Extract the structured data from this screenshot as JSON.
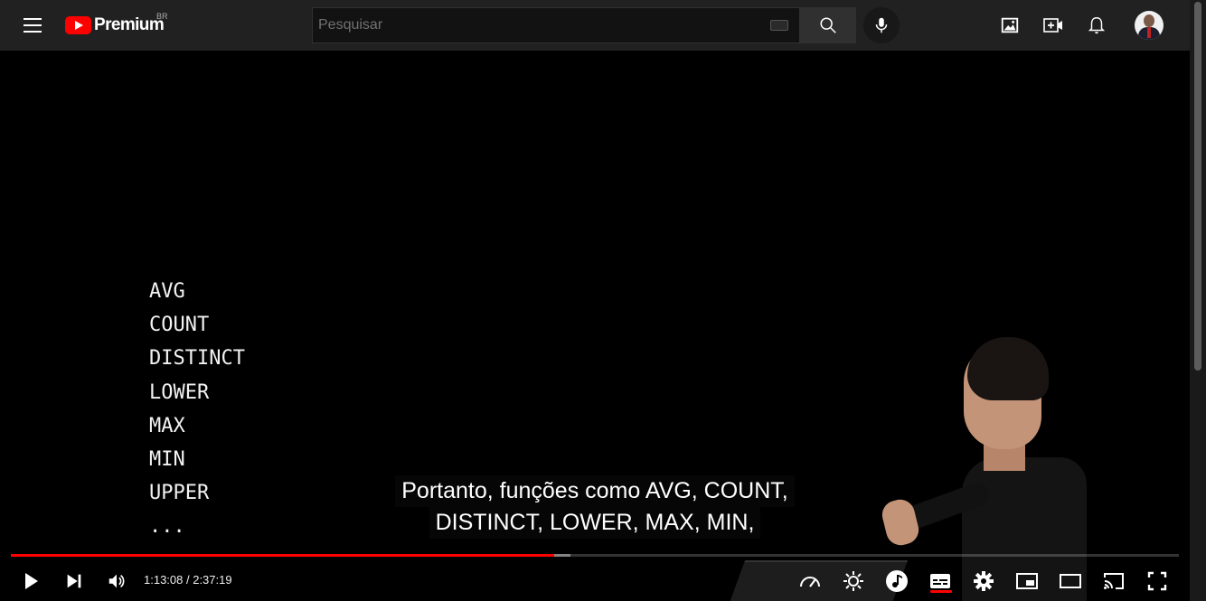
{
  "masthead": {
    "logo_text": "Premium",
    "country_code": "BR",
    "search_placeholder": "Pesquisar",
    "icons": [
      "menu-icon",
      "youtube-logo-icon",
      "keyboard-icon",
      "search-icon",
      "microphone-icon",
      "image-icon",
      "create-video-icon",
      "notifications-icon",
      "avatar"
    ]
  },
  "video": {
    "slide_items": [
      "AVG",
      "COUNT",
      "DISTINCT",
      "LOWER",
      "MAX",
      "MIN",
      "UPPER",
      "..."
    ],
    "captions": [
      "Portanto, funções como AVG, COUNT,",
      "DISTINCT, LOWER, MAX, MIN,"
    ]
  },
  "player": {
    "current_time": "1:13:08",
    "duration": "2:37:19",
    "time_display": "1:13:08 / 2:37:19",
    "played_fraction": 0.465,
    "loaded_fraction": 0.479,
    "progress_color": "#ff0000",
    "controls": [
      "play-icon",
      "next-icon",
      "volume-icon",
      "playback-speed-icon",
      "ambient-mode-icon",
      "music-icon",
      "subtitles-icon",
      "settings-icon",
      "miniplayer-icon",
      "theater-mode-icon",
      "cast-icon",
      "fullscreen-icon"
    ]
  }
}
